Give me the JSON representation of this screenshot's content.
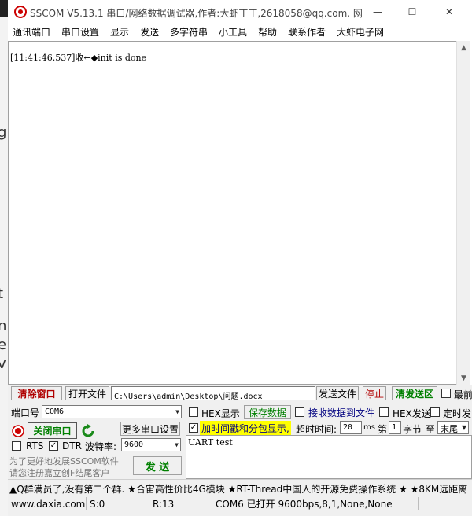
{
  "window": {
    "title": "SSCOM V5.13.1 串口/网络数据调试器,作者:大虾丁丁,2618058@qq.com. 网",
    "minimize": "—",
    "maximize": "☐",
    "close": "✕"
  },
  "menu": [
    "通讯端口",
    "串口设置",
    "显示",
    "发送",
    "多字符串",
    "小工具",
    "帮助",
    "联系作者",
    "大虾电子网"
  ],
  "receive": {
    "log": "[11:41:46.537]收←◆init is done"
  },
  "toolbar": {
    "clear_window": "清除窗口",
    "open_file": "打开文件",
    "file_path": "C:\\Users\\admin\\Desktop\\问题.docx",
    "send_file": "发送文件",
    "stop": "停止",
    "clear_send": "清发送区",
    "last": "最前"
  },
  "port": {
    "port_label": "端口号",
    "port_value": "COM6",
    "close_port": "关闭串口",
    "more_settings": "更多串口设置",
    "rts": "RTS",
    "dtr": "DTR",
    "baud_label": "波特率:",
    "baud_value": "9600"
  },
  "display_opts": {
    "hex_display": "HEX显示",
    "save_data": "保存数据",
    "recv_to_file": "接收数据到文件",
    "hex_send": "HEX发送",
    "timed_send": "定时发",
    "timestamp": "加时间戳和分包显示,",
    "timeout_label": "超时时间:",
    "timeout_value": "20",
    "ms": "ms",
    "nth": "第",
    "byte_value": "1",
    "byte_label": "字节",
    "to": "至",
    "end_value": "末尾"
  },
  "send": {
    "text": "UART test",
    "button": "发 送"
  },
  "promo": {
    "line1": "为了更好地发展SSCOM软件",
    "line2": "请您注册嘉立创F结尾客户"
  },
  "ticker": "▲Q群满员了,没有第二个群. ★合宙高性价比4G模块 ★RT-Thread中国人的开源免费操作系统 ★ ★8KM远距离",
  "status": {
    "site": "www.daxia.com",
    "sent": "S:0",
    "recv": "R:13",
    "port_state": "COM6 已打开  9600bps,8,1,None,None"
  },
  "colors": {
    "accent_green": "#008000",
    "accent_red": "#b00000",
    "highlight_yellow": "#ffff00"
  }
}
